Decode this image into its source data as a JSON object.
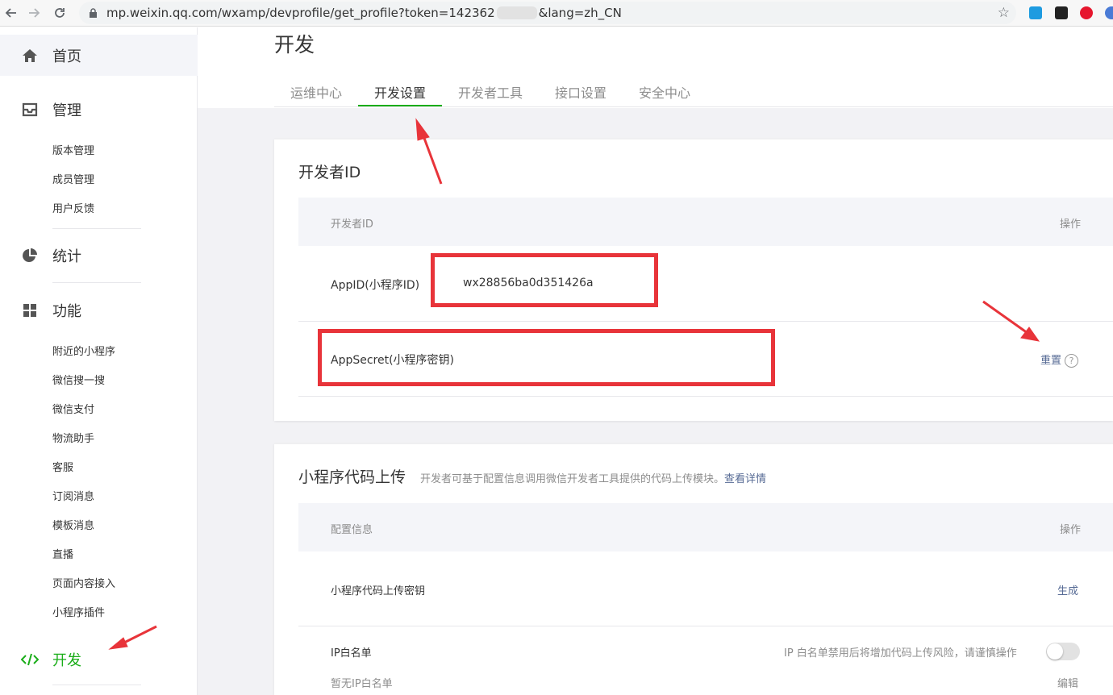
{
  "browser": {
    "url_prefix": "mp.weixin.qq.com/wxamp/devprofile/get_profile?token=142362",
    "url_suffix": "&lang=zh_CN"
  },
  "sidebar": {
    "home": "首页",
    "manage": "管理",
    "manage_items": [
      "版本管理",
      "成员管理",
      "用户反馈"
    ],
    "stats": "统计",
    "features": "功能",
    "feature_items": [
      "附近的小程序",
      "微信搜一搜",
      "微信支付",
      "物流助手",
      "客服",
      "订阅消息",
      "模板消息",
      "直播",
      "页面内容接入",
      "小程序插件"
    ],
    "develop": "开发"
  },
  "main": {
    "title": "开发",
    "tabs": [
      "运维中心",
      "开发设置",
      "开发者工具",
      "接口设置",
      "安全中心"
    ],
    "active_tab": "开发设置"
  },
  "dev_id_card": {
    "title": "开发者ID",
    "col_id": "开发者ID",
    "col_op": "操作",
    "appid_label": "AppID(小程序ID)",
    "appid_value": "wx28856ba0d351426a",
    "secret_label": "AppSecret(小程序密钥)",
    "reset_label": "重置",
    "help_glyph": "?"
  },
  "upload_card": {
    "title": "小程序代码上传",
    "desc": "开发者可基于配置信息调用微信开发者工具提供的代码上传模块。",
    "details_link": "查看详情",
    "col_config": "配置信息",
    "col_op": "操作",
    "key_label": "小程序代码上传密钥",
    "generate_label": "生成",
    "ip_label": "IP白名单",
    "ip_warning": "IP 白名单禁用后将增加代码上传风险，请谨慎操作",
    "ip_empty": "暂无IP白名单",
    "edit_label": "编辑",
    "ip_whitelist_enabled": false
  },
  "colors": {
    "accent_green": "#1aad19",
    "link_blue": "#576b95",
    "annotation_red": "#e8343a"
  }
}
